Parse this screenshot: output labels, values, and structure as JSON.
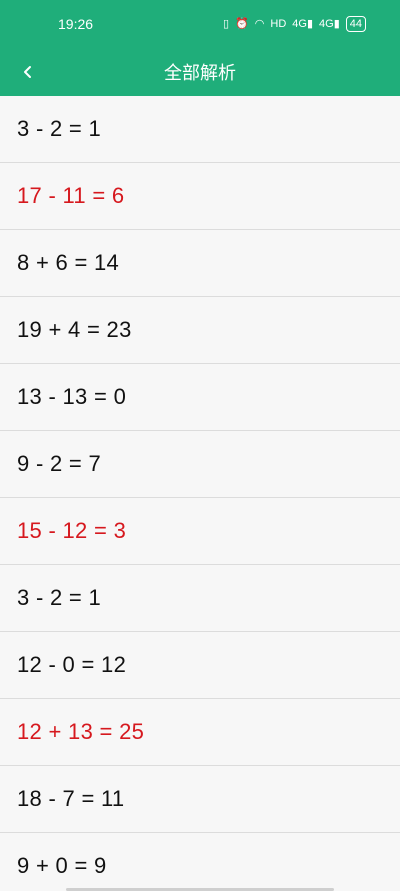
{
  "status_bar": {
    "time": "19:26",
    "icons": [
      {
        "name": "vibrate-icon",
        "glyph": "▯"
      },
      {
        "name": "alarm-icon",
        "glyph": "⏰"
      },
      {
        "name": "wifi-icon",
        "glyph": "◠"
      },
      {
        "name": "hd-icon",
        "glyph": "HD"
      },
      {
        "name": "signal-4g-icon-1",
        "glyph": "4G▮"
      },
      {
        "name": "signal-4g-icon-2",
        "glyph": "4G▮"
      }
    ],
    "battery": "44"
  },
  "header": {
    "title": "全部解析",
    "back_icon": "chevron-left-icon",
    "background": "#1fae7a"
  },
  "colors": {
    "correct": "#111111",
    "wrong": "#d6181e"
  },
  "items": [
    {
      "text": "3 - 2 = 1",
      "status": "correct"
    },
    {
      "text": "17 - 11 = 6",
      "status": "wrong"
    },
    {
      "text": "8 + 6 = 14",
      "status": "correct"
    },
    {
      "text": "19 + 4 = 23",
      "status": "correct"
    },
    {
      "text": "13 - 13 = 0",
      "status": "correct"
    },
    {
      "text": "9 - 2 = 7",
      "status": "correct"
    },
    {
      "text": "15 - 12 = 3",
      "status": "wrong"
    },
    {
      "text": "3 - 2 = 1",
      "status": "correct"
    },
    {
      "text": "12 - 0 = 12",
      "status": "correct"
    },
    {
      "text": "12 + 13 = 25",
      "status": "wrong"
    },
    {
      "text": "18 - 7 = 11",
      "status": "correct"
    },
    {
      "text": "9 + 0 = 9",
      "status": "correct"
    }
  ]
}
